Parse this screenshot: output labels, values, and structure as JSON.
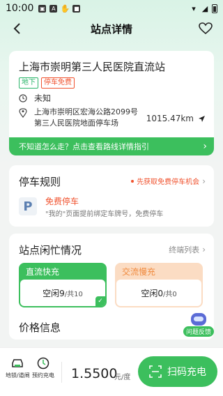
{
  "status_bar": {
    "time": "10:00",
    "icons": [
      "gallery-icon",
      "a-icon",
      "hand-icon",
      "app-icon"
    ]
  },
  "nav": {
    "title": "站点详情"
  },
  "station": {
    "name": "上海市崇明第三人民医院直流站",
    "tags": [
      "地下",
      "停车免费"
    ],
    "open_time": "未知",
    "address_line1": "上海市崇明区宏海公路2099号",
    "address_line2": "第三人民医院地面停车场",
    "distance": "1015.47km",
    "route_hint": "不知道怎么走？点击查看路线详情指引"
  },
  "parking": {
    "title": "停车规则",
    "link": "先获取免费停车机会",
    "free_title": "免费停车",
    "free_desc": "\"我的\"页面提前绑定车牌号，免费停车"
  },
  "busy": {
    "title": "站点闲忙情况",
    "terminal_link": "终端列表",
    "dc": {
      "label": "直流快充",
      "free_text": "空闲9",
      "total_text": "/共10"
    },
    "ac": {
      "label": "交流慢充",
      "free_text": "空闲0",
      "total_text": "/共0"
    }
  },
  "price": {
    "title": "价格信息"
  },
  "feedback": {
    "label": "问题反馈"
  },
  "bottom": {
    "lock_label": "地锁/道闸",
    "reserve_label": "预约充电",
    "price_value": "1.5500",
    "price_unit": "元/度",
    "scan_label": "扫码充电"
  },
  "colors": {
    "brand_green": "#3cbf5d",
    "accent_orange": "#f0522e",
    "ac_bg": "#fbdcc3"
  }
}
